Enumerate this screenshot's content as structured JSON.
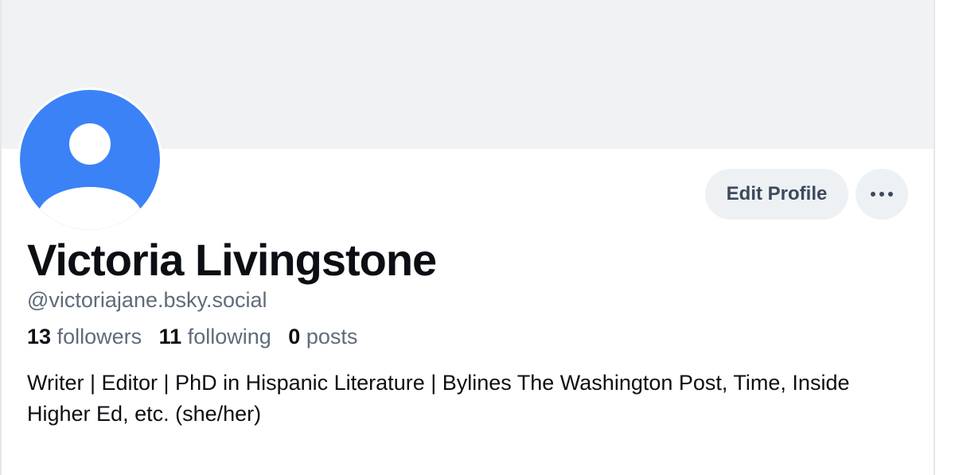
{
  "profile": {
    "display_name": "Victoria Livingstone",
    "handle": "@victoriajane.bsky.social",
    "bio": "Writer | Editor | PhD in Hispanic Literature | Bylines The Washington Post, Time, Inside Higher Ed, etc. (she/her)",
    "avatar_icon": "default-user-avatar-icon",
    "avatar_color": "#3b82f6"
  },
  "stats": {
    "followers_count": "13",
    "followers_label": "followers",
    "following_count": "11",
    "following_label": "following",
    "posts_count": "0",
    "posts_label": "posts"
  },
  "actions": {
    "edit_profile_label": "Edit Profile",
    "more_icon": "more-horizontal-icon"
  },
  "colors": {
    "banner": "#f1f2f4",
    "button_bg": "#eef1f4",
    "text_primary": "#0b0f14",
    "text_secondary": "#5f6b7a"
  }
}
